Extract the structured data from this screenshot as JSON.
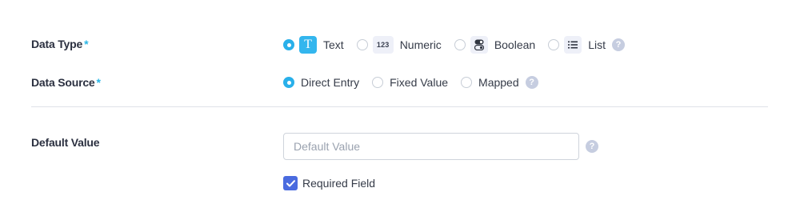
{
  "data_type": {
    "label": "Data Type",
    "required_marker": "*",
    "options": [
      {
        "label": "Text",
        "icon": "text-t-icon",
        "icon_glyph": "T",
        "selected": true
      },
      {
        "label": "Numeric",
        "icon": "numeric-123-icon",
        "icon_glyph": "123",
        "selected": false
      },
      {
        "label": "Boolean",
        "icon": "toggle-icon",
        "selected": false
      },
      {
        "label": "List",
        "icon": "list-icon",
        "selected": false
      }
    ],
    "help_glyph": "?"
  },
  "data_source": {
    "label": "Data Source",
    "required_marker": "*",
    "options": [
      {
        "label": "Direct Entry",
        "selected": true
      },
      {
        "label": "Fixed Value",
        "selected": false
      },
      {
        "label": "Mapped",
        "selected": false
      }
    ],
    "help_glyph": "?"
  },
  "default_value": {
    "label": "Default Value",
    "placeholder": "Default Value",
    "value": "",
    "help_glyph": "?"
  },
  "required_field": {
    "label": "Required Field",
    "checked": true
  },
  "colors": {
    "accent": "#29b0ea",
    "checkbox": "#4a6bdf",
    "required_marker": "#29b6e6"
  }
}
